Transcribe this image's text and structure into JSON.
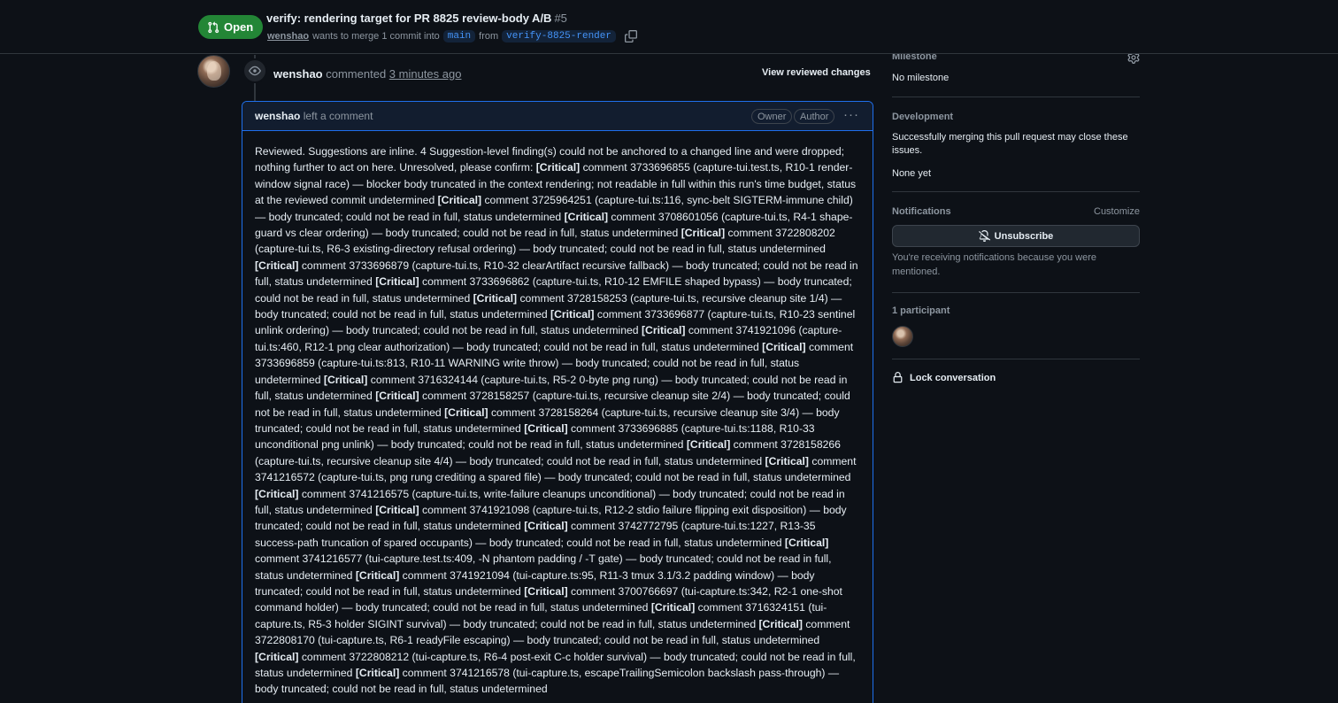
{
  "header": {
    "state": "Open",
    "title": "verify: rendering target for PR 8825 review-body A/B",
    "number": "#5",
    "author": "wenshao",
    "merge_text_1": "wants to merge 1 commit into",
    "base_branch": "main",
    "merge_text_2": "from",
    "head_branch": "verify-8825-render"
  },
  "review": {
    "author": "wenshao",
    "action": "commented",
    "time": "3 minutes ago",
    "view_changes": "View reviewed changes"
  },
  "comment": {
    "author": "wenshao",
    "action": "left a comment",
    "labels": [
      "Owner",
      "Author"
    ],
    "intro": "Reviewed. Suggestions are inline. 4 Suggestion-level finding(s) could not be anchored to a changed line and were dropped; nothing further to act on here. Unresolved, please confirm:",
    "tag": "[Critical]",
    "items": [
      "comment 3733696855 (capture-tui.test.ts, R10-1 render-window signal race) — blocker body truncated in the context rendering; not readable in full within this run's time budget, status at the reviewed commit undetermined",
      "comment 3725964251 (capture-tui.ts:116, sync-belt SIGTERM-immune child) — body truncated; could not be read in full, status undetermined",
      "comment 3708601056 (capture-tui.ts, R4-1 shape-guard vs clear ordering) — body truncated; could not be read in full, status undetermined",
      "comment 3722808202 (capture-tui.ts, R6-3 existing-directory refusal ordering) — body truncated; could not be read in full, status undetermined",
      "comment 3733696879 (capture-tui.ts, R10-32 clearArtifact recursive fallback) — body truncated; could not be read in full, status undetermined",
      "comment 3733696862 (capture-tui.ts, R10-12 EMFILE shaped bypass) — body truncated; could not be read in full, status undetermined",
      "comment 3728158253 (capture-tui.ts, recursive cleanup site 1/4) — body truncated; could not be read in full, status undetermined",
      "comment 3733696877 (capture-tui.ts, R10-23 sentinel unlink ordering) — body truncated; could not be read in full, status undetermined",
      "comment 3741921096 (capture-tui.ts:460, R12-1 png clear authorization) — body truncated; could not be read in full, status undetermined",
      "comment 3733696859 (capture-tui.ts:813, R10-11 WARNING write throw) — body truncated; could not be read in full, status undetermined",
      "comment 3716324144 (capture-tui.ts, R5-2 0-byte png rung) — body truncated; could not be read in full, status undetermined",
      "comment 3728158257 (capture-tui.ts, recursive cleanup site 2/4) — body truncated; could not be read in full, status undetermined",
      "comment 3728158264 (capture-tui.ts, recursive cleanup site 3/4) — body truncated; could not be read in full, status undetermined",
      "comment 3733696885 (capture-tui.ts:1188, R10-33 unconditional png unlink) — body truncated; could not be read in full, status undetermined",
      "comment 3728158266 (capture-tui.ts, recursive cleanup site 4/4) — body truncated; could not be read in full, status undetermined",
      "comment 3741216572 (capture-tui.ts, png rung crediting a spared file) — body truncated; could not be read in full, status undetermined",
      "comment 3741216575 (capture-tui.ts, write-failure cleanups unconditional) — body truncated; could not be read in full, status undetermined",
      "comment 3741921098 (capture-tui.ts, R12-2 stdio failure flipping exit disposition) — body truncated; could not be read in full, status undetermined",
      "comment 3742772795 (capture-tui.ts:1227, R13-35 success-path truncation of spared occupants) — body truncated; could not be read in full, status undetermined",
      "comment 3741216577 (tui-capture.test.ts:409, -N phantom padding / -T gate) — body truncated; could not be read in full, status undetermined",
      "comment 3741921094 (tui-capture.ts:95, R11-3 tmux 3.1/3.2 padding window) — body truncated; could not be read in full, status undetermined",
      "comment 3700766697 (tui-capture.ts:342, R2-1 one-shot command holder) — body truncated; could not be read in full, status undetermined",
      "comment 3716324151 (tui-capture.ts, R5-3 holder SIGINT survival) — body truncated; could not be read in full, status undetermined",
      "comment 3722808170 (tui-capture.ts, R6-1 readyFile escaping) — body truncated; could not be read in full, status undetermined",
      "comment 3722808212 (tui-capture.ts, R6-4 post-exit C-c holder survival) — body truncated; could not be read in full, status undetermined",
      "comment 3741216578 (tui-capture.ts, escapeTrailingSemicolon backslash pass-through) — body truncated; could not be read in full, status undetermined"
    ]
  },
  "sidebar": {
    "milestone_heading": "Milestone",
    "milestone_value": "No milestone",
    "development_heading": "Development",
    "development_text": "Successfully merging this pull request may close these issues.",
    "development_value": "None yet",
    "notifications_heading": "Notifications",
    "customize": "Customize",
    "unsubscribe": "Unsubscribe",
    "notify_reason": "You're receiving notifications because you were mentioned.",
    "participants": "1 participant",
    "lock": "Lock conversation"
  },
  "icons": [
    "git-pull-request-icon",
    "copy-icon",
    "eye-icon",
    "kebab-icon",
    "gear-icon",
    "bell-slash-icon",
    "lock-icon"
  ],
  "colors": {
    "open": "#238636",
    "accent": "#4493f8",
    "border_active": "#1f6feb",
    "bg": "#0d1117"
  }
}
